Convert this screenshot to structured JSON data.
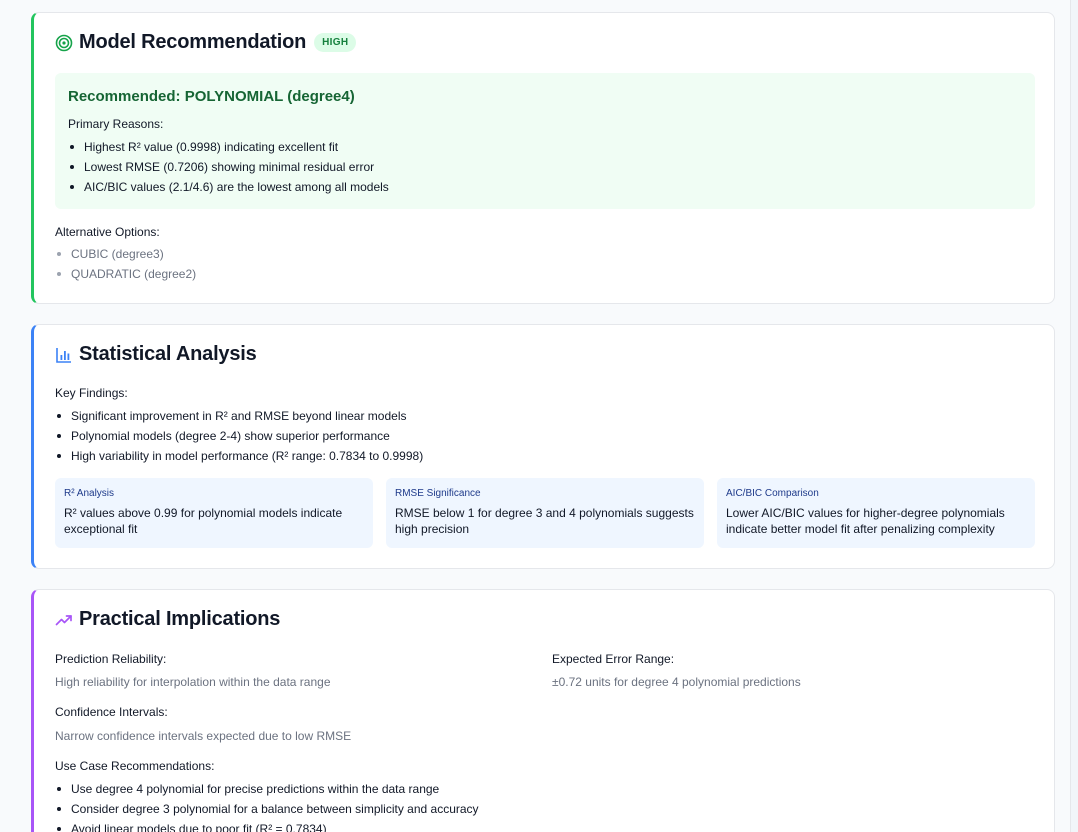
{
  "model_recommendation": {
    "title": "Model Recommendation",
    "badge": "HIGH",
    "recommended": "Recommended: POLYNOMIAL (degree4)",
    "primary_reasons_label": "Primary Reasons:",
    "reasons": [
      "Highest R² value (0.9998) indicating excellent fit",
      "Lowest RMSE (0.7206) showing minimal residual error",
      "AIC/BIC values (2.1/4.6) are the lowest among all models"
    ],
    "alternatives_label": "Alternative Options:",
    "alternatives": [
      "CUBIC (degree3)",
      "QUADRATIC (degree2)"
    ]
  },
  "statistical_analysis": {
    "title": "Statistical Analysis",
    "key_findings_label": "Key Findings:",
    "findings": [
      "Significant improvement in R² and RMSE beyond linear models",
      "Polynomial models (degree 2-4) show superior performance",
      "High variability in model performance (R² range: 0.7834 to 0.9998)"
    ],
    "metrics": [
      {
        "title": "R² Analysis",
        "desc": "R² values above 0.99 for polynomial models indicate exceptional fit"
      },
      {
        "title": "RMSE Significance",
        "desc": "RMSE below 1 for degree 3 and 4 polynomials suggests high precision"
      },
      {
        "title": "AIC/BIC Comparison",
        "desc": "Lower AIC/BIC values for higher-degree polynomials indicate better model fit after penalizing complexity"
      }
    ]
  },
  "practical_implications": {
    "title": "Practical Implications",
    "prediction_reliability_label": "Prediction Reliability:",
    "prediction_reliability": "High reliability for interpolation within the data range",
    "expected_error_label": "Expected Error Range:",
    "expected_error": "±0.72 units for degree 4 polynomial predictions",
    "confidence_label": "Confidence Intervals:",
    "confidence": "Narrow confidence intervals expected due to low RMSE",
    "use_case_label": "Use Case Recommendations:",
    "use_cases": [
      "Use degree 4 polynomial for precise predictions within the data range",
      "Consider degree 3 polynomial for a balance between simplicity and accuracy",
      "Avoid linear models due to poor fit (R² = 0.7834)"
    ]
  },
  "colors": {
    "green_accent": "#22c55e",
    "blue_accent": "#3b82f6",
    "purple_accent": "#a855f7"
  },
  "icons": {
    "model_recommendation": "target-icon",
    "statistical_analysis": "bar-chart-icon",
    "practical_implications": "trending-up-icon"
  }
}
